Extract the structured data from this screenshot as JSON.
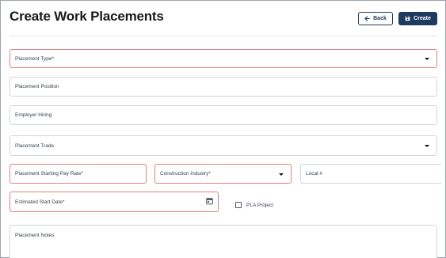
{
  "header": {
    "title": "Create Work Placements",
    "back_label": "Back",
    "create_label": "Create"
  },
  "form": {
    "placement_type": "Placement Type*",
    "placement_position": "Placement Position",
    "employer_hiring": "Employer Hiring",
    "placement_trade": "Placement Trade",
    "starting_pay_rate": "Placement Starting Pay Rate*",
    "construction_industry": "Construction Industry*",
    "local_number": "Local #",
    "estimated_start_date": "Estimated Start Date*",
    "pla_project": "PLA Project",
    "placement_notes": "Placement Notes"
  },
  "colors": {
    "primary": "#1e3a5f",
    "error_border": "#e08080",
    "default_border": "#d1d5db"
  },
  "icons": [
    "arrow-left-icon",
    "save-icon",
    "chevron-down-icon",
    "calendar-icon"
  ]
}
